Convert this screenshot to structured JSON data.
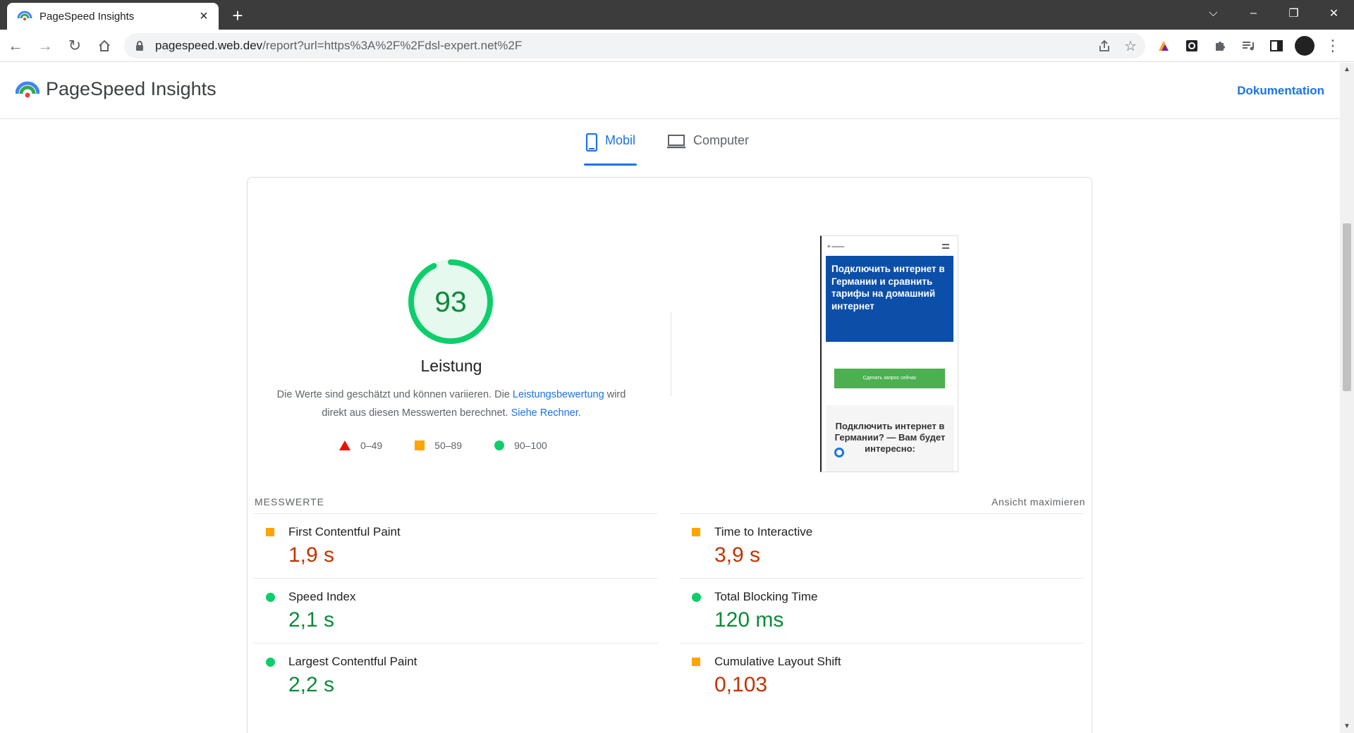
{
  "browser": {
    "tab_title": "PageSpeed Insights",
    "url_host": "pagespeed.web.dev",
    "url_rest": "/report?url=https%3A%2F%2Fdsl-expert.net%2F",
    "icons": [
      "back-icon",
      "forward-icon",
      "reload-icon",
      "home-icon",
      "lock-icon",
      "share-icon",
      "star-icon",
      "extension-icon",
      "puzzle-icon",
      "media-icon",
      "sidepanel-icon",
      "avatar",
      "menu-icon"
    ]
  },
  "header": {
    "title": "PageSpeed Insights",
    "doc_link": "Dokumentation"
  },
  "device_tabs": [
    {
      "label": "Mobil",
      "active": true
    },
    {
      "label": "Computer",
      "active": false
    }
  ],
  "score": {
    "value": "93",
    "fraction": 0.93,
    "color": "#0cce6b",
    "title": "Leistung",
    "desc_1": "Die Werte sind geschätzt und können variieren. Die ",
    "desc_link_1": "Leistungsbewertung",
    "desc_2": " wird direkt aus diesen Messwerten berechnet. ",
    "desc_link_2": "Siehe Rechner."
  },
  "legend": [
    {
      "shape": "triangle",
      "label": "0–49",
      "color": "#eb0f00"
    },
    {
      "shape": "square",
      "label": "50–89",
      "color": "#ffa400"
    },
    {
      "shape": "circle",
      "label": "90–100",
      "color": "#0cce6b"
    }
  ],
  "screenshot": {
    "hero_text": "Подключить интернет в Германии и сравнить тарифы на домашний интернет",
    "button_text": "Сделать запрос сейчас",
    "sub_text": "Подключить интернет в Германии? — Вам будет интересно:"
  },
  "metrics": {
    "heading": "MESSWERTE",
    "expand": "Ansicht maximieren",
    "items": [
      {
        "name": "First Contentful Paint",
        "value": "1,9 s",
        "rating": "average"
      },
      {
        "name": "Time to Interactive",
        "value": "3,9 s",
        "rating": "average"
      },
      {
        "name": "Speed Index",
        "value": "2,1 s",
        "rating": "good"
      },
      {
        "name": "Total Blocking Time",
        "value": "120 ms",
        "rating": "good"
      },
      {
        "name": "Largest Contentful Paint",
        "value": "2,2 s",
        "rating": "good"
      },
      {
        "name": "Cumulative Layout Shift",
        "value": "0,103",
        "rating": "average"
      }
    ]
  },
  "colors": {
    "accent": "#1a73e8",
    "good": "#0cce6b",
    "average": "#ffa400",
    "poor": "#eb0f00"
  }
}
